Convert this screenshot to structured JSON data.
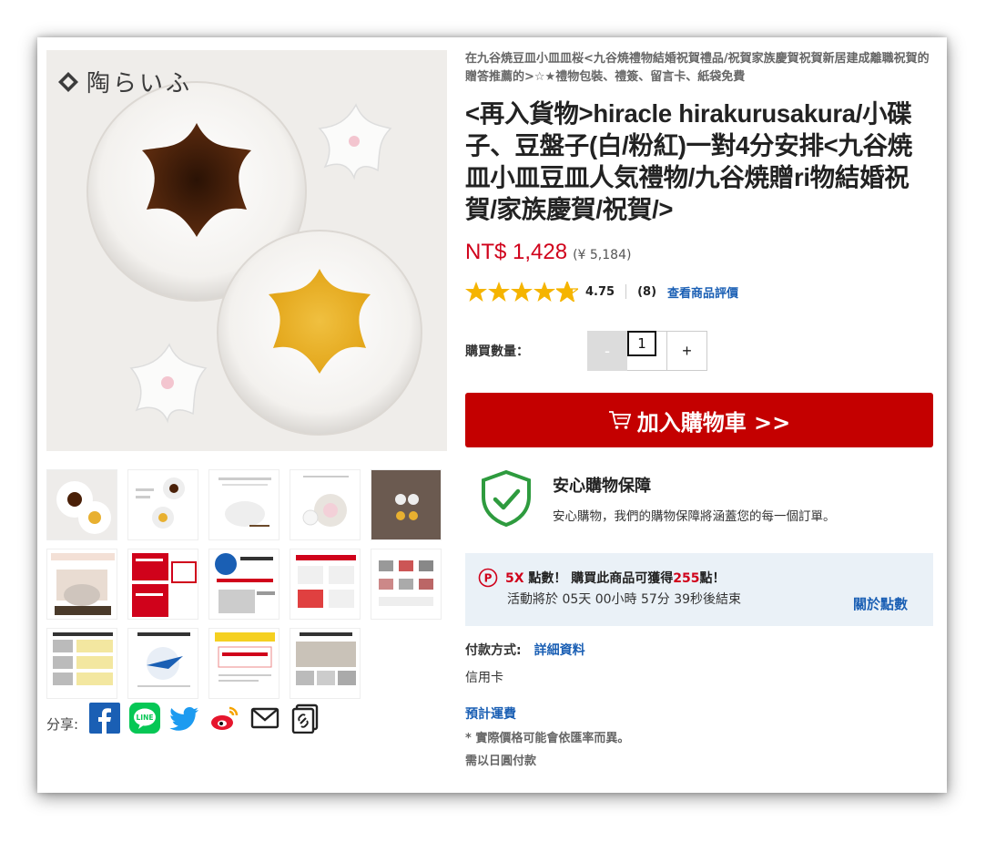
{
  "product": {
    "brand_text": "陶らいふ",
    "category_text": "在九谷焼豆皿小皿皿桜<九谷焼禮物結婚祝賀禮品/祝賀家族慶賀祝賀新居建成離職祝賀的贈答推薦的>☆★禮物包裝、禮簽、留言卡、紙袋免費",
    "title": "<再入貨物>hiracle hirakurusakura/小碟子、豆盤子(白/粉紅)一對4分安排<九谷焼皿小皿豆皿人気禮物/九谷焼贈ri物結婚祝賀/家族慶賀/祝賀/>",
    "price": "NT$ 1,428",
    "price_jpy": "(¥ 5,184)"
  },
  "rating": {
    "value": "4.75",
    "stars": 4.75,
    "count": "(8)",
    "review_link": "查看商品評價"
  },
  "quantity": {
    "label": "購買數量：",
    "minus": "-",
    "value": "1",
    "plus": "+"
  },
  "cart": {
    "button_label": "加入購物車 >>"
  },
  "guarantee": {
    "title": "安心購物保障",
    "description": "安心購物，我們的購物保障將涵蓋您的每一個訂單。"
  },
  "points": {
    "multiplier": "5X",
    "text_a": "點數！ 購買此商品可獲得",
    "amount": "255",
    "text_b": "點！",
    "countdown": "活動將於 05天 00小時 57分 39秒後結束",
    "link": "關於點數"
  },
  "payment": {
    "label": "付款方式:",
    "details_link": "詳細資料",
    "method": "信用卡",
    "shipping_link": "預計運費",
    "note1": "* 實際價格可能會依匯率而異。",
    "note2": "需以日圓付款"
  },
  "share": {
    "label": "分享:",
    "icons": [
      "facebook-icon",
      "line-icon",
      "twitter-icon",
      "weibo-icon",
      "mail-icon",
      "copy-link-icon"
    ]
  },
  "colors": {
    "accent_red": "#c40000",
    "price_red": "#d0021b",
    "link_blue": "#1a5fb4",
    "star_yellow": "#f5b400",
    "shield_green": "#2e9b3e",
    "points_bg": "#eaf1f7"
  }
}
